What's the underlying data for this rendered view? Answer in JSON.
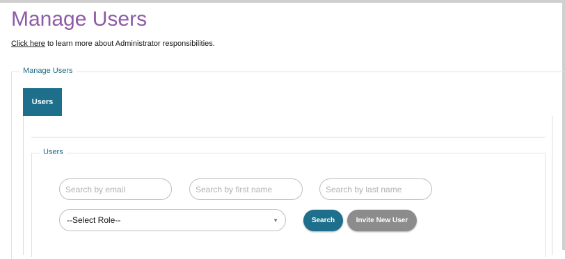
{
  "page": {
    "title": "Manage Users",
    "intro_link": "Click here",
    "intro_text": " to learn more about Administrator responsibilities."
  },
  "outer_section": {
    "legend": "Manage Users"
  },
  "tabs": [
    {
      "label": "Users",
      "active": true
    }
  ],
  "users_section": {
    "legend": "Users",
    "search_email": {
      "placeholder": "Search by email",
      "value": ""
    },
    "search_first_name": {
      "placeholder": "Search by first name",
      "value": ""
    },
    "search_last_name": {
      "placeholder": "Search by last name",
      "value": ""
    },
    "role_select": {
      "selected": "--Select Role--",
      "icon": "chevron-down-icon"
    },
    "search_button": "Search",
    "invite_button": "Invite New User"
  },
  "colors": {
    "title": "#8e5ba6",
    "accent": "#1d6f8c",
    "invite_button": "#8c8c8c",
    "legend": "#1f6b85"
  }
}
